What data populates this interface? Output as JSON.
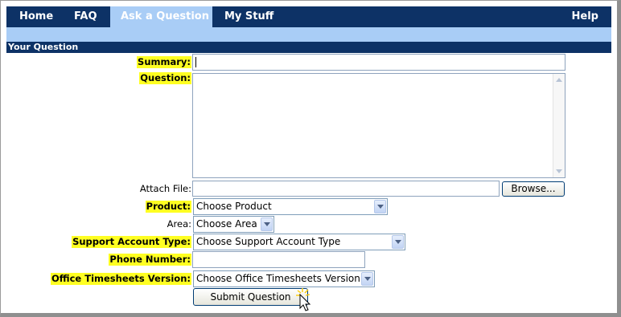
{
  "nav": {
    "items": [
      {
        "label": "Home"
      },
      {
        "label": "FAQ"
      },
      {
        "label": "Ask a Question"
      },
      {
        "label": "My Stuff"
      }
    ],
    "help_label": "Help",
    "active": "Ask a Question"
  },
  "section": {
    "title": "Your Question"
  },
  "form": {
    "summary": {
      "label": "Summary:",
      "value": ""
    },
    "question": {
      "label": "Question:",
      "value": ""
    },
    "attach": {
      "label": "Attach File:",
      "value": "",
      "browse_label": "Browse..."
    },
    "product": {
      "label": "Product:",
      "selected": "Choose Product"
    },
    "area": {
      "label": "Area:",
      "selected": "Choose Area"
    },
    "support_account_type": {
      "label": "Support Account Type:",
      "selected": "Choose Support Account Type"
    },
    "phone": {
      "label": "Phone Number:",
      "value": ""
    },
    "timesheets_version": {
      "label": "Office Timesheets Version:",
      "selected": "Choose Office Timesheets Version"
    },
    "submit_label": "Submit Question"
  },
  "colors": {
    "nav_bg": "#0d3266",
    "nav_active_bg": "#a9cdf6",
    "required_highlight": "#ffff22"
  }
}
